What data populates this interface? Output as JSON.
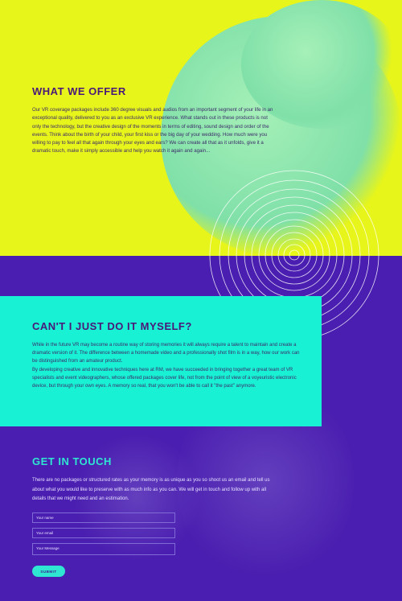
{
  "offer": {
    "title": "WHAT WE OFFER",
    "body": "Our VR coverage packages include 360 degree visuals and audios from an important segment of your life in an exceptional quality, delivered to you as an exclusive VR experience. What stands out in these products is not only the technology, but the creative design of the moments in terms of editing, sound design and order of the events. Think about the birth of your child, your first kiss or the big day of your wedding. How much were you willing to pay to feel all that again through your eyes and ears? We can create all that as it unfolds, give it a dramatic touch, make it simply accessible and help you watch it again and again..."
  },
  "diy": {
    "title": "CAN'T I JUST DO IT MYSELF?",
    "paragraph1": "While in the future VR may become a routine way of storing memories it will always require a talent to maintain and create a dramatic version of it. The difference between a homemade video and a professionally shot film is in a way, how our work can be distinguished from an amateur product.",
    "paragraph2": "By developing creative and innovative techniques here at RM, we have succeeded in bringing together a great team of VR specialists and event videographers, whose offered packages cover life, not from the point of view of a voyeuristic electronic device, but through your own eyes. A memory so real, that you won't be able to call it \"the past\" anymore."
  },
  "contact": {
    "title": "GET IN TOUCH",
    "body": "There are no packages or structured rates as your memory is as unique as you so shoot us an email and tell us about what you would like to preserve with as much info as you can. We will get in touch and follow up with all details that we might need and an estimation.",
    "name_placeholder": "Your name",
    "email_placeholder": "Your email",
    "message_placeholder": "Your Message",
    "submit_label": "SUBMIT"
  },
  "colors": {
    "yellow": "#e7f51a",
    "purple": "#4a1eb0",
    "cyan": "#19f1d4",
    "title_dark": "#4a1878",
    "accent": "#2fe6d2"
  }
}
